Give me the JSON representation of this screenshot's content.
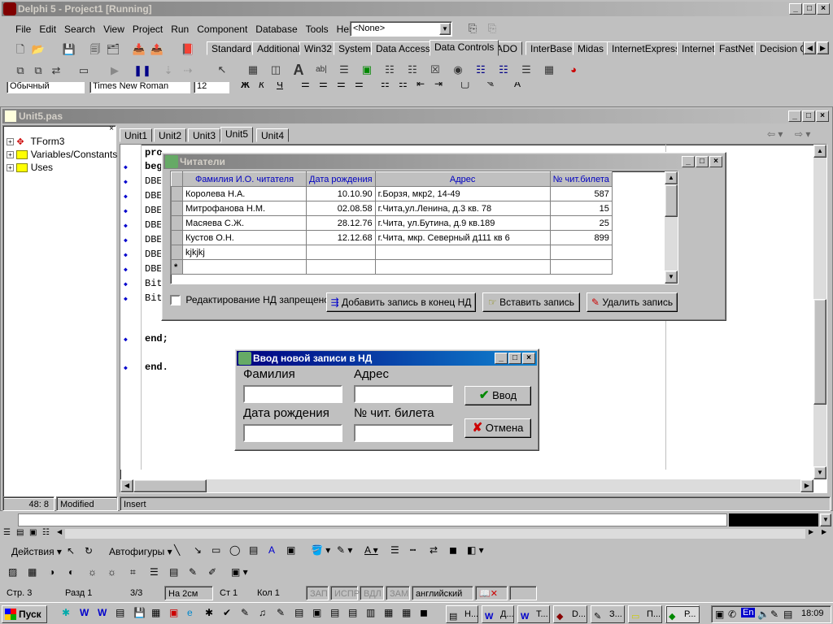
{
  "app": {
    "title": "Delphi 5 - Project1 [Running]",
    "menu": [
      "File",
      "Edit",
      "Search",
      "View",
      "Project",
      "Run",
      "Component",
      "Database",
      "Tools",
      "Help"
    ],
    "combo_value": "<None>",
    "palette_tabs": [
      "Standard",
      "Additional",
      "Win32",
      "System",
      "Data Access",
      "Data Controls",
      "ADO",
      "InterBase",
      "Midas",
      "InternetExpress",
      "Internet",
      "FastNet",
      "Decision C"
    ],
    "selected_palette_tab": "Data Controls"
  },
  "word_format": {
    "style": "Обычный",
    "font": "Times New Roman",
    "size": "12"
  },
  "editor": {
    "title": "Unit5.pas",
    "tree": [
      "TForm3",
      "Variables/Constants",
      "Uses"
    ],
    "tabs": [
      "Unit1",
      "Unit2",
      "Unit3",
      "Unit5",
      "Unit4"
    ],
    "selected_tab": "Unit5",
    "code_lines": [
      "pro",
      "beg",
      "DBE",
      "DBE",
      "DBE",
      "DBE",
      "DBE",
      "DBE",
      "DBE",
      "Bit",
      "Bit",
      "",
      "end;",
      "",
      "end."
    ],
    "status": {
      "position": "48:  8",
      "modified": "Modified",
      "mode": "Insert"
    }
  },
  "readers_form": {
    "title": "Читатели",
    "columns": [
      "Фамилия И.О. читателя",
      "Дата рождения",
      "Адрес",
      "№ чит.билета"
    ],
    "rows": [
      [
        "Королева Н.А.",
        "10.10.90",
        "г.Борзя, мкр2, 14-49",
        "587"
      ],
      [
        "Митрофанова Н.М.",
        "02.08.58",
        "г.Чита,ул.Ленина,  д.3 кв. 78",
        "15"
      ],
      [
        "Масяева С.Ж.",
        "28.12.76",
        "г.Чита, ул.Бутина, д.9 кв.189",
        "25"
      ],
      [
        "Кустов О.Н.",
        "12.12.68",
        "г.Чита, мкр. Северный д111 кв 6",
        "899"
      ],
      [
        "kjkjkj",
        "",
        "",
        ""
      ],
      [
        "",
        "",
        "",
        ""
      ]
    ],
    "checkbox_label": "Редактирование НД запрещено",
    "buttons": {
      "append": "Добавить запись в конец НД",
      "insert": "Вставить запись",
      "delete": "Удалить запись"
    }
  },
  "new_record_form": {
    "title": "Ввод новой записи в НД",
    "labels": {
      "surname": "Фамилия",
      "address": "Адрес",
      "birth": "Дата рождения",
      "ticket": "№ чит. билета"
    },
    "buttons": {
      "ok": "Ввод",
      "cancel": "Отмена"
    }
  },
  "draw_toolbar": {
    "actions": "Действия",
    "autoshapes": "Автофигуры"
  },
  "word_status": [
    "Стр. 3",
    "Разд 1",
    "3/3",
    "На 2см",
    "Ст 1",
    "Кол 1",
    "ЗАП",
    "ИСПР",
    "ВДЛ",
    "ЗАМ",
    "английский"
  ],
  "taskbar": {
    "start": "Пуск",
    "tasks": [
      "Н...",
      "Д...",
      "Т...",
      "D...",
      "З...",
      "П...",
      "Р..."
    ],
    "lang": "En",
    "time": "18:09"
  },
  "colors": {
    "title_active": "#000080",
    "title_inactive": "#808080",
    "desktop": "#c0c0c0",
    "header_text": "#0000c0"
  }
}
